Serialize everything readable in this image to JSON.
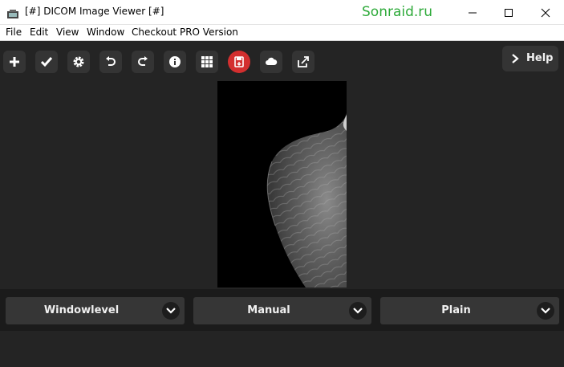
{
  "window": {
    "title": "[#] DICOM Image Viewer [#]",
    "watermark": "Sonraid.ru"
  },
  "menu": [
    "File",
    "Edit",
    "View",
    "Window",
    "Checkout PRO Version"
  ],
  "toolbar": {
    "icons": [
      "plus-icon",
      "check-icon",
      "gear-icon",
      "undo-icon",
      "redo-icon",
      "info-icon",
      "grid-icon",
      "save-icon",
      "cloud-icon",
      "share-icon"
    ],
    "active_color": "#d32f2f",
    "help_label": "Help"
  },
  "dropdowns": [
    {
      "selected": "Windowlevel"
    },
    {
      "selected": "Manual"
    },
    {
      "selected": "Plain"
    }
  ]
}
